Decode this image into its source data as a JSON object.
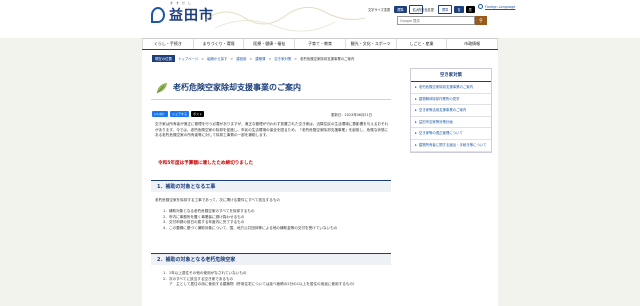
{
  "header": {
    "logo_text": "益田市",
    "logo_ruby": "ますだし",
    "font_size_label": "文字サイズ変更",
    "font_standard": "標準",
    "font_large": "拡大",
    "color_label": "背景色変更",
    "color_standard": "標準",
    "color_blue": "青",
    "color_black": "黒",
    "language": "Foreign Language",
    "search_placeholder": "Google 提供",
    "search_icon": "search-icon"
  },
  "nav": {
    "items": [
      "くらし・手続き",
      "まちづくり・環境",
      "医療・健康・福祉",
      "子育て・教育",
      "観光・文化・スポーツ",
      "しごと・産業",
      "市政情報"
    ]
  },
  "breadcrumb": {
    "here": "現在の位置",
    "items": [
      "トップページ",
      "組織から探す",
      "建設部",
      "建築課",
      "空き家対策"
    ],
    "current": "老朽危険空家除却支援事業のご案内"
  },
  "page": {
    "title": "老朽危険空家除却支援事業のご案内",
    "social": [
      "いいね！",
      "シェアする",
      "ポスト"
    ],
    "updated": "更新日：2023年06月21日",
    "intro": "空き家は所有者が適正に管理を行う必要がありますが、適正な管理が行われず放置された空き家は、近隣住民の生活環境に悪影響を与えるおそれがあります。今では、老朽危険空家の除却を促進し、市民の生活環境の保全を図るため、「老朽危険空家除却支援事業」を創設し、危険な状態にある老朽危険空家の所有者等に対して除却工事費の一部を補助します。",
    "notice": "令和5年度は予算額に達したため締切りました",
    "section1_title": "1．補助の対象となる工事",
    "section1_para": "老朽危険空家を除却する工事であって、次に掲げる要件にすべて該当するもの",
    "section1_list": [
      "1．補助対象となる老朽危険空家のすべてを除却するもの",
      "2．市内に事務所を置く事業者に請け負わせるもの",
      "3．交付申請の前日の属する年度内に完了するもの",
      "4．この要綱に基づく補助対象について、国、地方公共団体等による他の補助金等の交付を受けていないもの"
    ],
    "section2_title": "2．補助の対象となる老朽危険空家",
    "section2_list": [
      "1．1年以上居住その他の使用がなされていないもの",
      "2．次のすべてに該当する空き家であるもの",
      "ア　主として居住の用に使用する建築物（併用住宅については延べ面積の2分の1以上を居住の用途に使用するもの）"
    ]
  },
  "sidebar": {
    "heading": "空き家対策",
    "links": [
      "老朽危険空家除却支援事業のご案内",
      "建物解体除却作業所の見学",
      "空き家等活用支援事業のご案内",
      "益田市空家等対策計画",
      "空き家等の適正管理について",
      "建物所有者に関する届出・手続き等について"
    ]
  }
}
